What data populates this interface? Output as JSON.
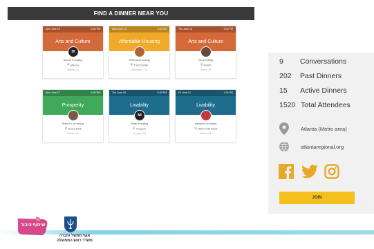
{
  "header": {
    "title": "FIND A DINNER NEAR YOU"
  },
  "cards": [
    {
      "date": "Mon June 10",
      "time": "6:30 PM",
      "topic": "Arts and Culture",
      "color": "#d4693a",
      "avatar": "DI",
      "avatar_bg": "#222222",
      "host": "Denise is hosting",
      "venue": "Marcus",
      "city": "Atlanta, GA"
    },
    {
      "date": "Wed June 12",
      "time": "6:30 PM",
      "topic": "Affordable Housing",
      "color": "#f0a929",
      "avatar": "",
      "avatar_bg": "#b0643a",
      "host": "Rebecca is hosting",
      "venue": "Tucci Center",
      "city": "Woodstock, GA"
    },
    {
      "date": "Thu June 13",
      "time": "6:30 PM",
      "topic": "Arts and Culture",
      "color": "#d4693a",
      "avatar": "",
      "avatar_bg": "#6a4a3a",
      "host": "Ru is hosting",
      "venue": "Duluth",
      "city": "Duluth, GA"
    },
    {
      "date": "Mon June 17",
      "time": "6:30 PM",
      "topic": "Prosperity",
      "color": "#3faa5b",
      "avatar": "",
      "avatar_bg": "#7a5a4a",
      "host": "Robert A. is hosting",
      "venue": "Grove Park",
      "city": "Atlanta, GA"
    },
    {
      "date": "Tue June 18",
      "time": "6:30 PM",
      "topic": "Livability",
      "color": "#1f6d8c",
      "avatar": "MI",
      "avatar_bg": "#222222",
      "host": "Marty is hosting",
      "venue": "Conyers",
      "city": "Conyers, GA"
    },
    {
      "date": "Fri June 21",
      "time": "4:30 PM",
      "topic": "Livability",
      "color": "#1f6d8c",
      "avatar": "",
      "avatar_bg": "#c23a3a",
      "host": "Katharine is hosting",
      "venue": "Old Fourth Ward",
      "city": "Atlanta, GA"
    }
  ],
  "stats": [
    {
      "value": "9",
      "label": "Conversations"
    },
    {
      "value": "202",
      "label": "Past Dinners"
    },
    {
      "value": "15",
      "label": "Active Dinners"
    },
    {
      "value": "1520",
      "label": "Total Attendees"
    }
  ],
  "location": {
    "region": "Atlanta (Metro area)",
    "website": "atlantaregional.org"
  },
  "social": [
    "facebook-icon",
    "twitter-icon",
    "instagram-icon"
  ],
  "join_label": "JOIN",
  "accent": "#f4c01e",
  "footer": {
    "partner_logo_text": "שיתוף ציבור",
    "gov_text": "אגף ממשל וחברה משרד ראש הממשלה"
  }
}
